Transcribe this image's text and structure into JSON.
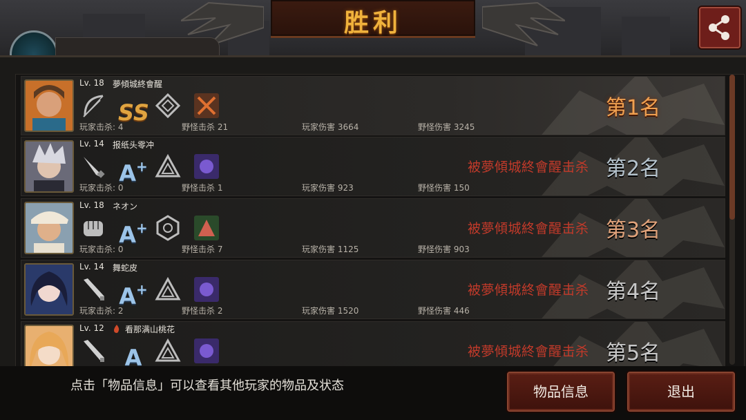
{
  "header": {
    "title": "胜利",
    "share_icon": "share-icon"
  },
  "players": [
    {
      "level": "Lv. 18",
      "name": "夢傾城終會醒",
      "weapon_icon": "bow-icon",
      "grade": "SS",
      "grade_plus": "",
      "rank_icon": "diamond-rank-icon",
      "killed_by": "",
      "stats": [
        "玩家击杀: 4",
        "野怪击杀 21",
        "玩家伤害 3664",
        "野怪伤害 3245"
      ],
      "place": "第1名"
    },
    {
      "level": "Lv. 14",
      "name": "报纸头零冲",
      "weapon_icon": "knife-icon",
      "grade": "A",
      "grade_plus": "+",
      "rank_icon": "triangle-rank-icon",
      "killed_by": "被夢傾城終會醒击杀",
      "stats": [
        "玩家击杀: 0",
        "野怪击杀 1",
        "玩家伤害 923",
        "野怪伤害 150"
      ],
      "place": "第2名"
    },
    {
      "level": "Lv. 18",
      "name": "ネオン",
      "weapon_icon": "fist-icon",
      "grade": "A",
      "grade_plus": "+",
      "rank_icon": "hexagon-rank-icon",
      "killed_by": "被夢傾城終會醒击杀",
      "stats": [
        "玩家击杀: 0",
        "野怪击杀 7",
        "玩家伤害 1125",
        "野怪伤害 903"
      ],
      "place": "第3名"
    },
    {
      "level": "Lv. 14",
      "name": "舞蛇皮",
      "weapon_icon": "bat-icon",
      "grade": "A",
      "grade_plus": "+",
      "rank_icon": "triangle-rank-icon",
      "killed_by": "被夢傾城終會醒击杀",
      "stats": [
        "玩家击杀: 2",
        "野怪击杀 2",
        "玩家伤害 1520",
        "野怪伤害 446"
      ],
      "place": "第4名"
    },
    {
      "level": "Lv. 12",
      "name": "看那满山桃花",
      "weapon_icon": "bat-icon",
      "grade": "A",
      "grade_plus": "",
      "rank_icon": "triangle-rank-icon",
      "killed_by": "被夢傾城終會醒击杀",
      "stats": [
        "",
        "",
        "",
        ""
      ],
      "place": "第5名"
    }
  ],
  "footer": {
    "hint": "点击「物品信息」可以查看其他玩家的物品及状态",
    "items_button": "物品信息",
    "exit_button": "退出"
  },
  "colors": {
    "title": "#f0b23c",
    "killed_text": "#c23a2a",
    "first_place": "#f0a050",
    "button_bg": "#5a1e14"
  }
}
